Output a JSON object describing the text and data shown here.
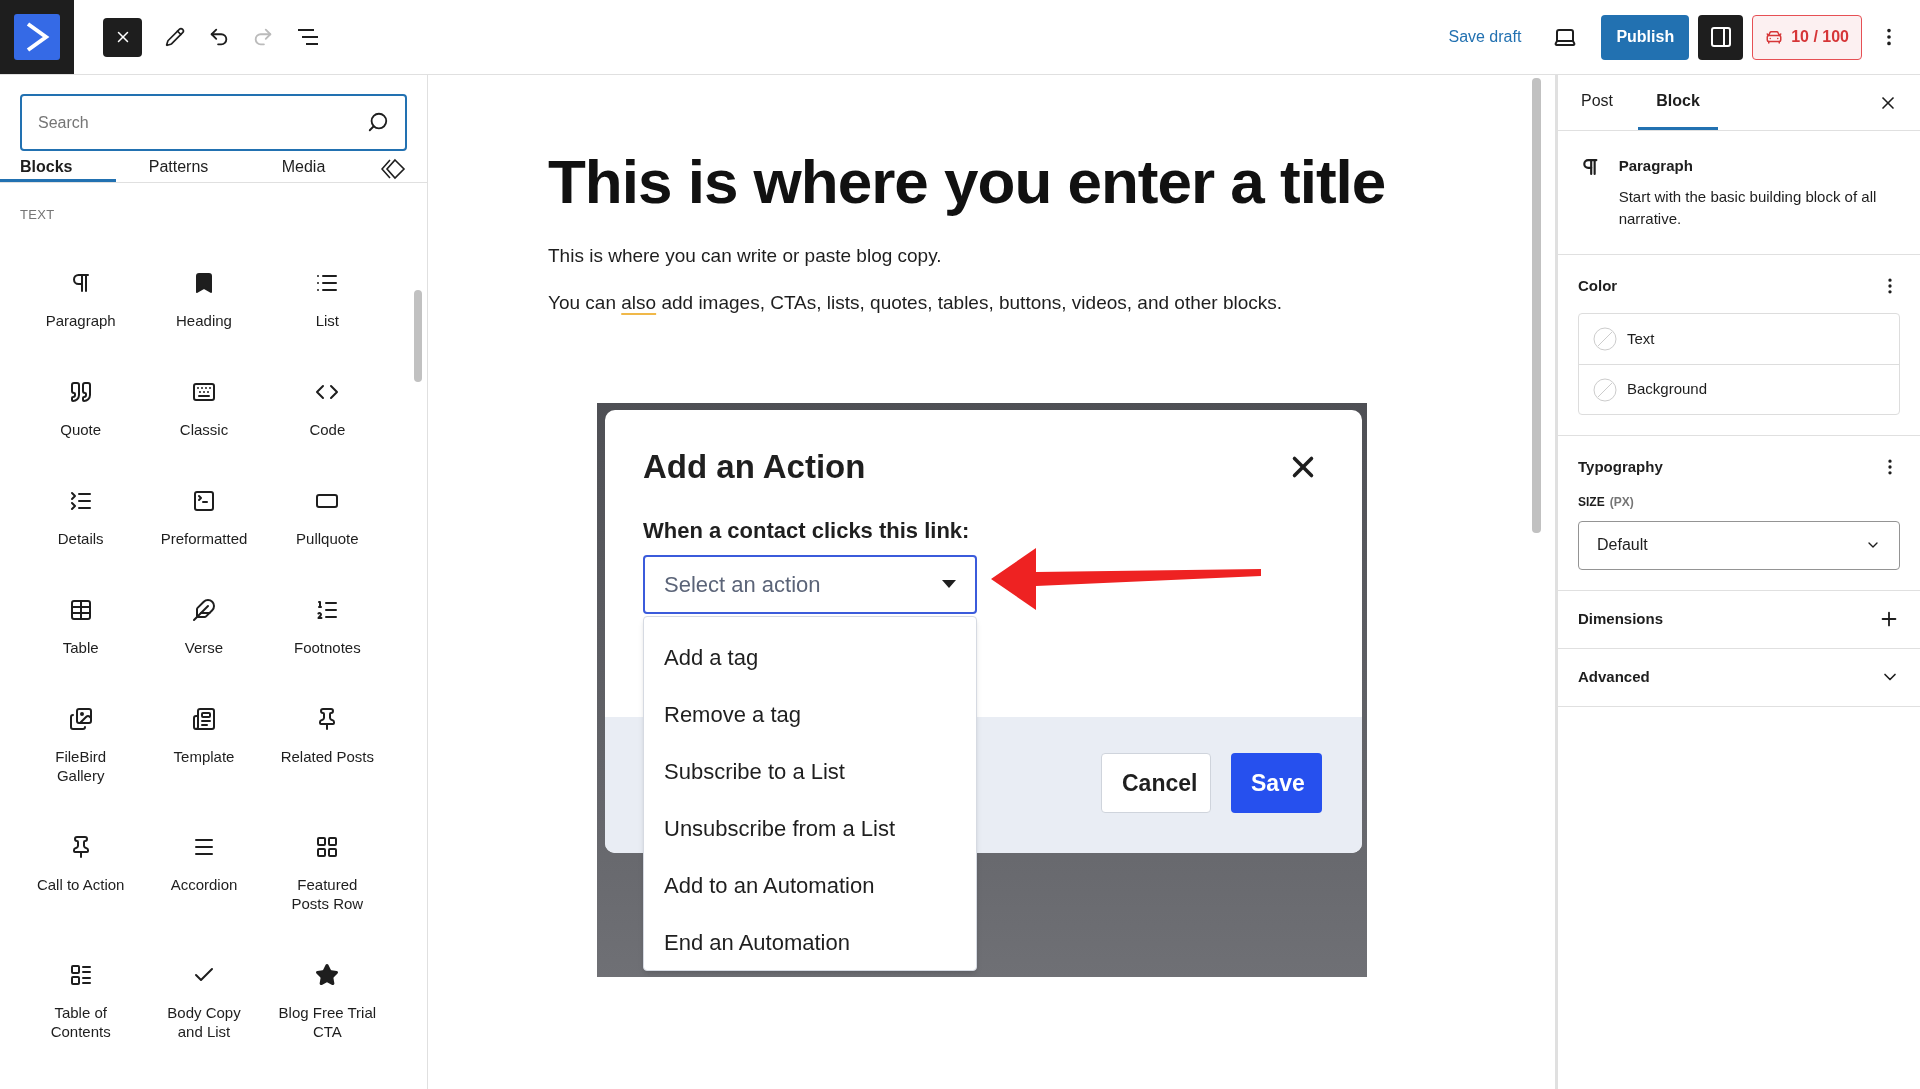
{
  "toolbar": {
    "save_draft": "Save draft",
    "publish": "Publish",
    "score": "10 / 100"
  },
  "inserter": {
    "search": {
      "placeholder": "Search"
    },
    "tabs": [
      {
        "label": "Blocks",
        "selected": true
      },
      {
        "label": "Patterns",
        "selected": false
      },
      {
        "label": "Media",
        "selected": false
      }
    ],
    "category": "TEXT",
    "blocks": [
      "Paragraph",
      "Heading",
      "List",
      "Quote",
      "Classic",
      "Code",
      "Details",
      "Preformatted",
      "Pullquote",
      "Table",
      "Verse",
      "Footnotes",
      "FileBird Gallery",
      "Template",
      "Related Posts",
      "Call to Action",
      "Accordion",
      "Featured Posts Row",
      "Table of Contents",
      "Body Copy and List",
      "Blog Free Trial CTA"
    ]
  },
  "editor": {
    "title": "This is where you enter a title",
    "paragraphs": [
      [
        {
          "text": "This is where you can write or paste blog copy.",
          "flagged": false
        }
      ],
      [
        {
          "text": "You can ",
          "flagged": false
        },
        {
          "text": "also",
          "flagged": true
        },
        {
          "text": " add images, CTAs, lists, quotes, tables, buttons, videos, and other blocks.",
          "flagged": false
        }
      ]
    ],
    "image": {
      "modal": {
        "title": "Add an Action",
        "label": "When a contact clicks this link:",
        "select": {
          "placeholder": "Select an action"
        },
        "options": [
          "Add a tag",
          "Remove a tag",
          "Subscribe to a List",
          "Unsubscribe from a List",
          "Add to an Automation",
          "End an Automation"
        ],
        "buttons": [
          {
            "label": "Cancel",
            "kind": "secondary"
          },
          {
            "label": "Save",
            "kind": "primary"
          }
        ]
      }
    }
  },
  "sidebar": {
    "tabs": [
      {
        "label": "Post",
        "selected": false
      },
      {
        "label": "Block",
        "selected": true
      }
    ],
    "block": {
      "name": "Paragraph",
      "description": "Start with the basic building block of all narrative."
    },
    "color": {
      "title": "Color",
      "items": [
        "Text",
        "Background"
      ]
    },
    "typography": {
      "title": "Typography",
      "size_label": "SIZE",
      "size_unit": "(PX)",
      "size_value": "Default"
    },
    "sections": [
      {
        "title": "Dimensions",
        "kind": "add"
      },
      {
        "title": "Advanced",
        "kind": "toggle",
        "expanded": false
      }
    ]
  }
}
